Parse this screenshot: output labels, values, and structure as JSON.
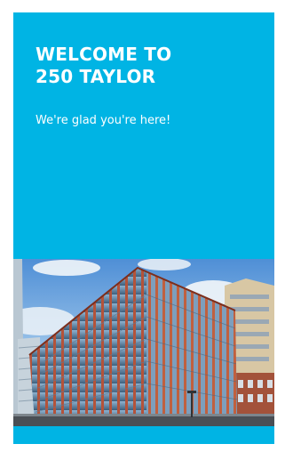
{
  "headline": {
    "line1": "WELCOME TO",
    "line2": "250 TAYLOR"
  },
  "subtitle": "We're glad you're here!",
  "colors": {
    "brand": "#00b4e4",
    "text": "#ffffff"
  },
  "photo": {
    "subject": "building-photo"
  }
}
